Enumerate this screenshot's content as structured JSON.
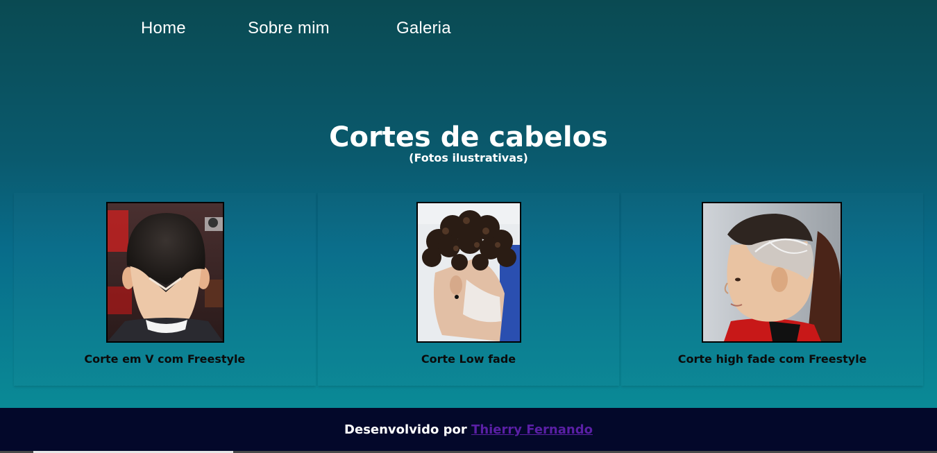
{
  "nav": {
    "items": [
      {
        "label": "Home"
      },
      {
        "label": "Sobre mim"
      },
      {
        "label": "Galeria"
      }
    ]
  },
  "hero": {
    "title": "Cortes de cabelos",
    "subtitle": "(Fotos ilustrativas)"
  },
  "gallery": {
    "cards": [
      {
        "caption": "Corte em V com Freestyle",
        "image": "back-of-head-v-cut-photo"
      },
      {
        "caption": "Corte Low fade",
        "image": "curly-low-fade-photo"
      },
      {
        "caption": "Corte high fade com Freestyle",
        "image": "boy-high-fade-freestyle-photo"
      }
    ]
  },
  "footer": {
    "prefix": "Desenvolvido por",
    "author": "Thierry Fernando"
  },
  "colors": {
    "background_top": "#0a4a52",
    "background_bottom": "#0a8a96",
    "footer_bg": "#03082a",
    "footer_link": "#5a1fa5"
  }
}
